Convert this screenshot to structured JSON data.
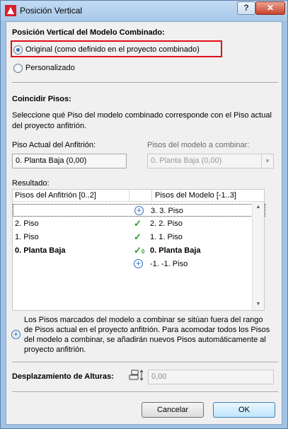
{
  "window": {
    "title": "Posición Vertical",
    "help_label": "?",
    "close_label": "✕"
  },
  "vertical_position": {
    "heading": "Posición Vertical del Modelo Combinado:",
    "options": [
      {
        "label": "Original (como definido en el proyecto combinado)",
        "selected": true
      },
      {
        "label": "Personalizado",
        "selected": false
      }
    ]
  },
  "match_floors": {
    "heading": "Coincidir Pisos:",
    "description": "Seleccione qué Piso del modelo combinado corresponde con el Piso actual del proyecto anfitrión.",
    "host_label": "Piso Actual del Anfitrión:",
    "host_value": "0. Planta Baja (0,00)",
    "model_label": "Pisos del modelo a combinar:",
    "model_value": "0. Planta Baja (0,00)"
  },
  "result": {
    "heading": "Resultado:",
    "col_host": "Pisos del Anfitrión [0..2]",
    "col_model": "Pisos del Modelo [-1..3]",
    "rows": [
      {
        "host": "",
        "status": "add",
        "model": "3. 3. Piso",
        "bold": false
      },
      {
        "host": "2. Piso",
        "status": "check",
        "model": "2. 2. Piso",
        "bold": false
      },
      {
        "host": "1. Piso",
        "status": "check",
        "model": "1. 1. Piso",
        "bold": false
      },
      {
        "host": "0. Planta Baja",
        "status": "check-current",
        "model": "0. Planta Baja",
        "bold": true
      },
      {
        "host": "",
        "status": "add",
        "model": "-1. -1. Piso",
        "bold": false
      }
    ]
  },
  "note": "Los Pisos marcados del modelo a combinar se sitúan fuera del rango de Pisos actual en el proyecto anfitrión. Para acomodar todos los Pisos del modelo a combinar, se añadirán nuevos Pisos automáticamente al proyecto anfitrión.",
  "offset": {
    "label": "Desplazamiento de Alturas:",
    "value": "0,00"
  },
  "buttons": {
    "cancel": "Cancelar",
    "ok": "OK"
  },
  "colors": {
    "highlight": "#e0101a",
    "check": "#2a9a2a",
    "add": "#2f6fc1"
  }
}
